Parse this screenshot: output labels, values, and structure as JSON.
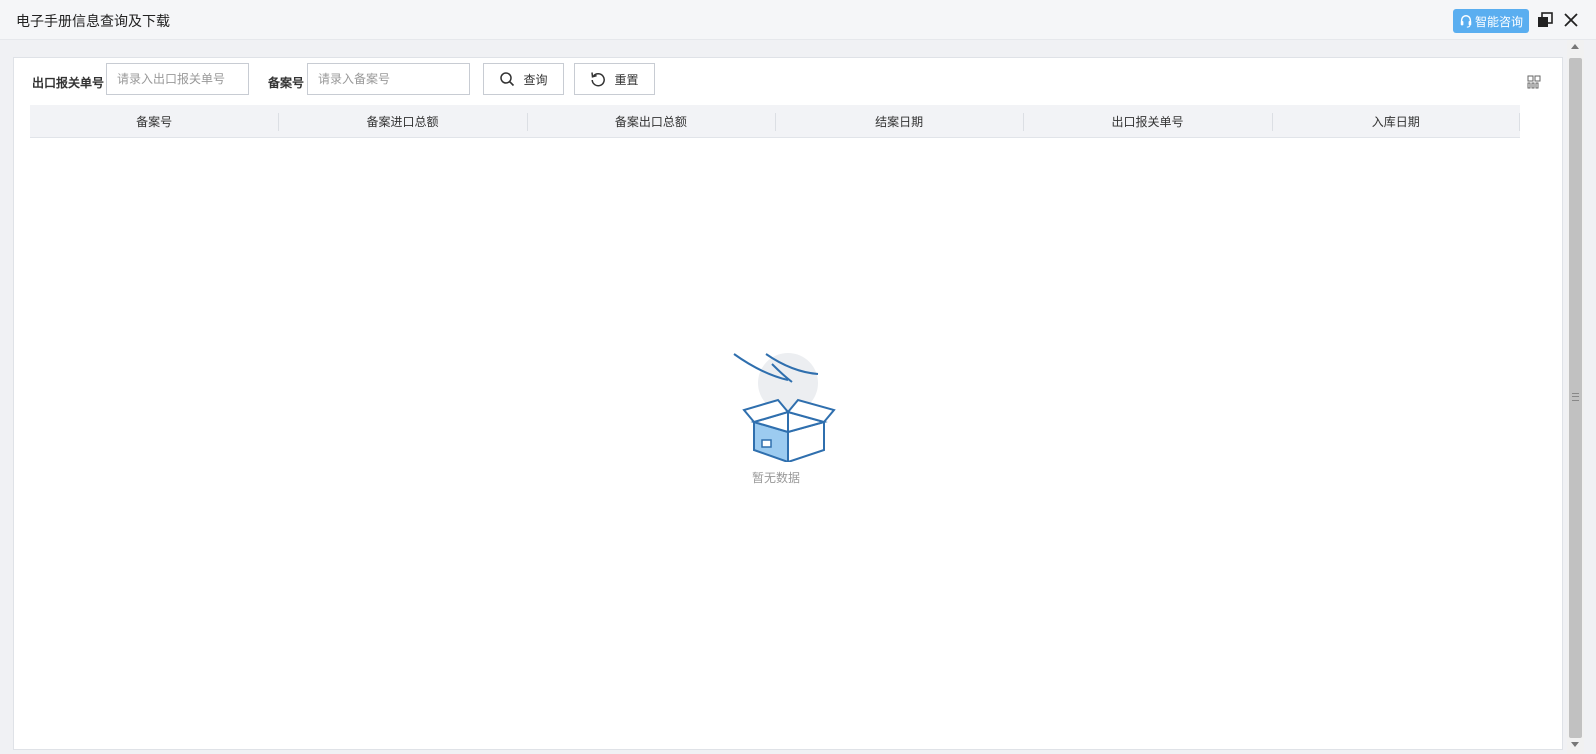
{
  "window": {
    "title": "电子手册信息查询及下载",
    "consult_label": "智能咨询",
    "accent_color": "#5aaef0"
  },
  "search": {
    "export_no_label": "出口报关单号",
    "export_no_placeholder": "请录入出口报关单号",
    "record_no_label": "备案号",
    "record_no_placeholder": "请录入备案号",
    "query_label": "查询",
    "reset_label": "重置"
  },
  "table": {
    "columns": [
      "备案号",
      "备案进口总额",
      "备案出口总额",
      "结案日期",
      "出口报关单号",
      "入库日期"
    ],
    "rows": []
  },
  "empty": {
    "text": "暂无数据",
    "icon": "empty-box-icon"
  }
}
